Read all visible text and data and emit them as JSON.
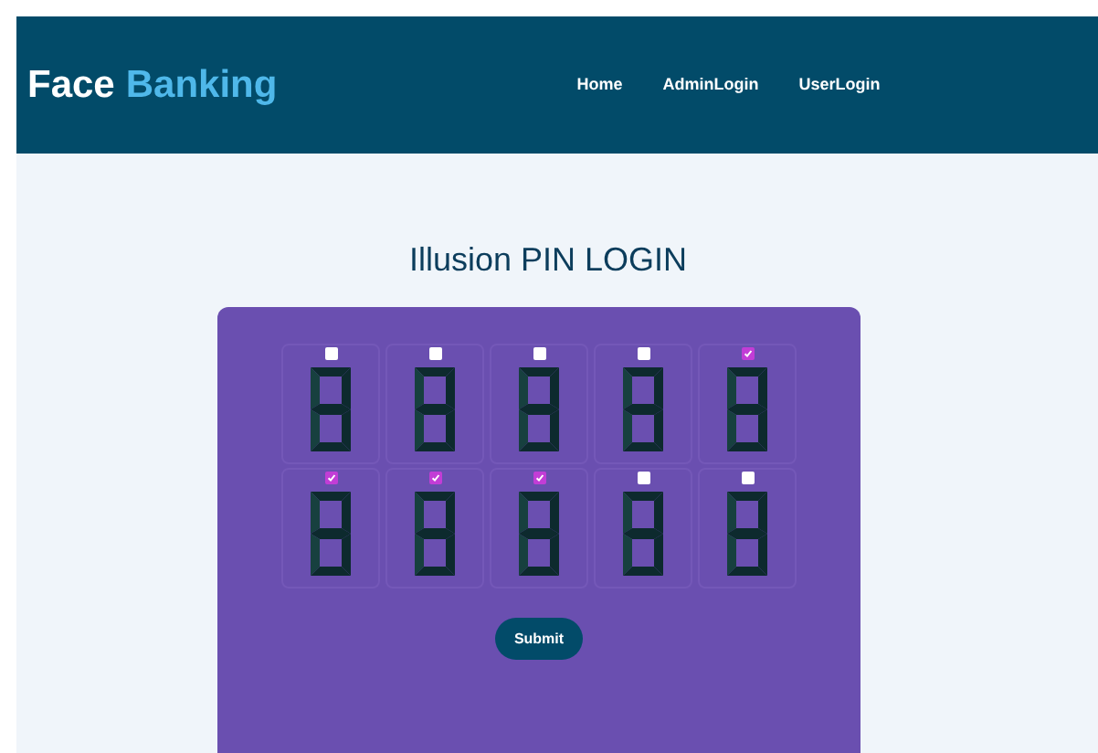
{
  "header": {
    "brand_first": "Face",
    "brand_second": "Banking",
    "nav": [
      "Home",
      "AdminLogin",
      "UserLogin"
    ]
  },
  "title": "Illusion PIN LOGIN",
  "cells": [
    {
      "checked": false
    },
    {
      "checked": false
    },
    {
      "checked": false
    },
    {
      "checked": false
    },
    {
      "checked": true
    },
    {
      "checked": true
    },
    {
      "checked": true
    },
    {
      "checked": true
    },
    {
      "checked": false
    },
    {
      "checked": false
    }
  ],
  "submit": "Submit"
}
